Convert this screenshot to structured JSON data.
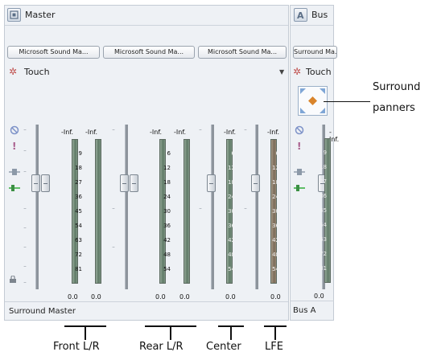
{
  "master": {
    "title": "Master",
    "devices": [
      "Microsoft Sound Ma...",
      "Microsoft Sound Ma...",
      "Microsoft Sound Ma..."
    ],
    "automation_mode": "Touch",
    "peak_labels": [
      "-Inf.",
      "-Inf.",
      "-Inf.",
      "-Inf.",
      "-Inf.",
      "-Inf."
    ],
    "scale_front": [
      "9",
      "18",
      "27",
      "36",
      "45",
      "54",
      "63",
      "72",
      "81"
    ],
    "scale_rear": [
      "6",
      "12",
      "18",
      "24",
      "30",
      "36",
      "42",
      "48",
      "54"
    ],
    "values": [
      "0.0",
      "0.0",
      "0.0",
      "0.0",
      "0.0",
      "0.0"
    ],
    "footer_name": "Surround Master"
  },
  "bus": {
    "title": "Bus",
    "device": "Surround Ma...",
    "automation_mode": "Touch",
    "peak_label": "-Inf.",
    "scale": [
      "9",
      "18",
      "27",
      "36",
      "45",
      "54",
      "63",
      "72",
      "81"
    ],
    "value": "0.0",
    "footer_name": "Bus A"
  },
  "annotations": {
    "surround": "Surround",
    "panners": "panners",
    "front": "Front L/R",
    "rear": "Rear L/R",
    "center": "Center",
    "lfe": "LFE"
  },
  "colors": {
    "panel_bg": "#eef1f5",
    "meter": "#6f8a76",
    "lfe_meter": "#8b7b67",
    "panner_arrow": "#7fa6d6",
    "panner_dot": "#d9842b"
  },
  "icons": [
    "master-bus-icon",
    "bus-icon",
    "gear-icon",
    "dropdown-arrow-icon",
    "mute-icon",
    "solo-icon",
    "link-icon",
    "pan-icon",
    "lock-icon"
  ]
}
